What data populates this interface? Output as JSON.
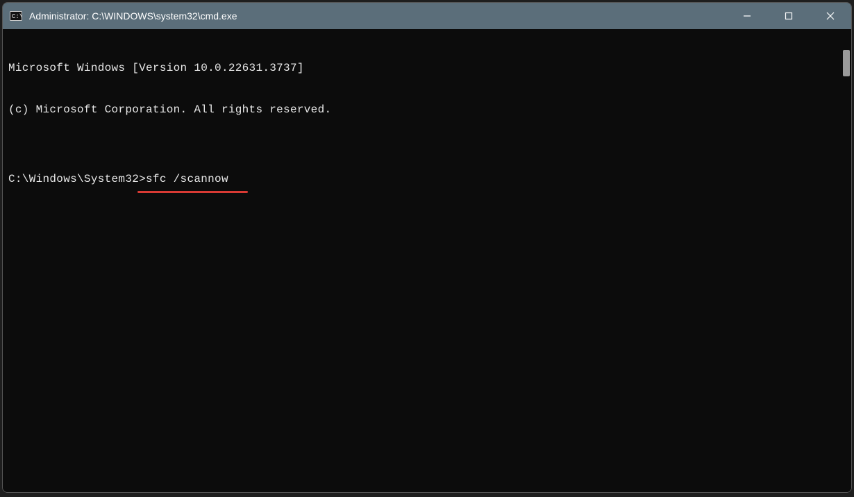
{
  "window": {
    "title": "Administrator: C:\\WINDOWS\\system32\\cmd.exe"
  },
  "terminal": {
    "lines": {
      "line1": "Microsoft Windows [Version 10.0.22631.3737]",
      "line2": "(c) Microsoft Corporation. All rights reserved.",
      "blank": "",
      "prompt": "C:\\Windows\\System32>",
      "command": "sfc /scannow"
    }
  },
  "annotation": {
    "underline_color": "#d93a34"
  }
}
